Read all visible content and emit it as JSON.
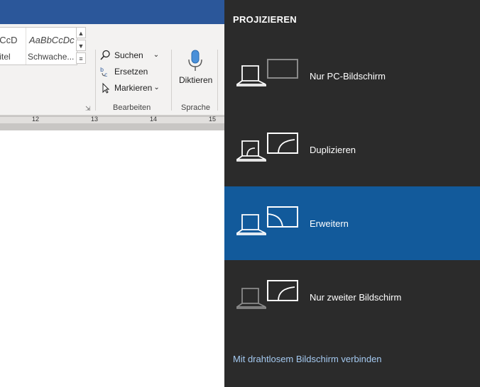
{
  "ribbon": {
    "styles": [
      {
        "sample": "bCcD",
        "name": "rtitel"
      },
      {
        "sample": "AaBbCcDc",
        "name": "Schwache..."
      }
    ],
    "editing": {
      "search_label": "Suchen",
      "replace_label": "Ersetzen",
      "select_label": "Markieren",
      "group_label": "Bearbeiten"
    },
    "voice": {
      "dictate_label": "Diktieren",
      "group_label": "Sprache"
    },
    "ruler_numbers": [
      "12",
      "13",
      "14",
      "15"
    ]
  },
  "project_panel": {
    "title": "PROJIZIEREN",
    "options": [
      {
        "label": "Nur PC-Bildschirm",
        "icon": "pc-screen-only-icon",
        "selected": false
      },
      {
        "label": "Duplizieren",
        "icon": "duplicate-icon",
        "selected": false
      },
      {
        "label": "Erweitern",
        "icon": "extend-icon",
        "selected": true
      },
      {
        "label": "Nur zweiter Bildschirm",
        "icon": "second-screen-only-icon",
        "selected": false
      }
    ],
    "connect_link": "Mit drahtlosem Bildschirm verbinden",
    "colors": {
      "panel_bg": "#2b2b2b",
      "selected_bg": "#125a9b",
      "link": "#a4c9f0"
    }
  }
}
